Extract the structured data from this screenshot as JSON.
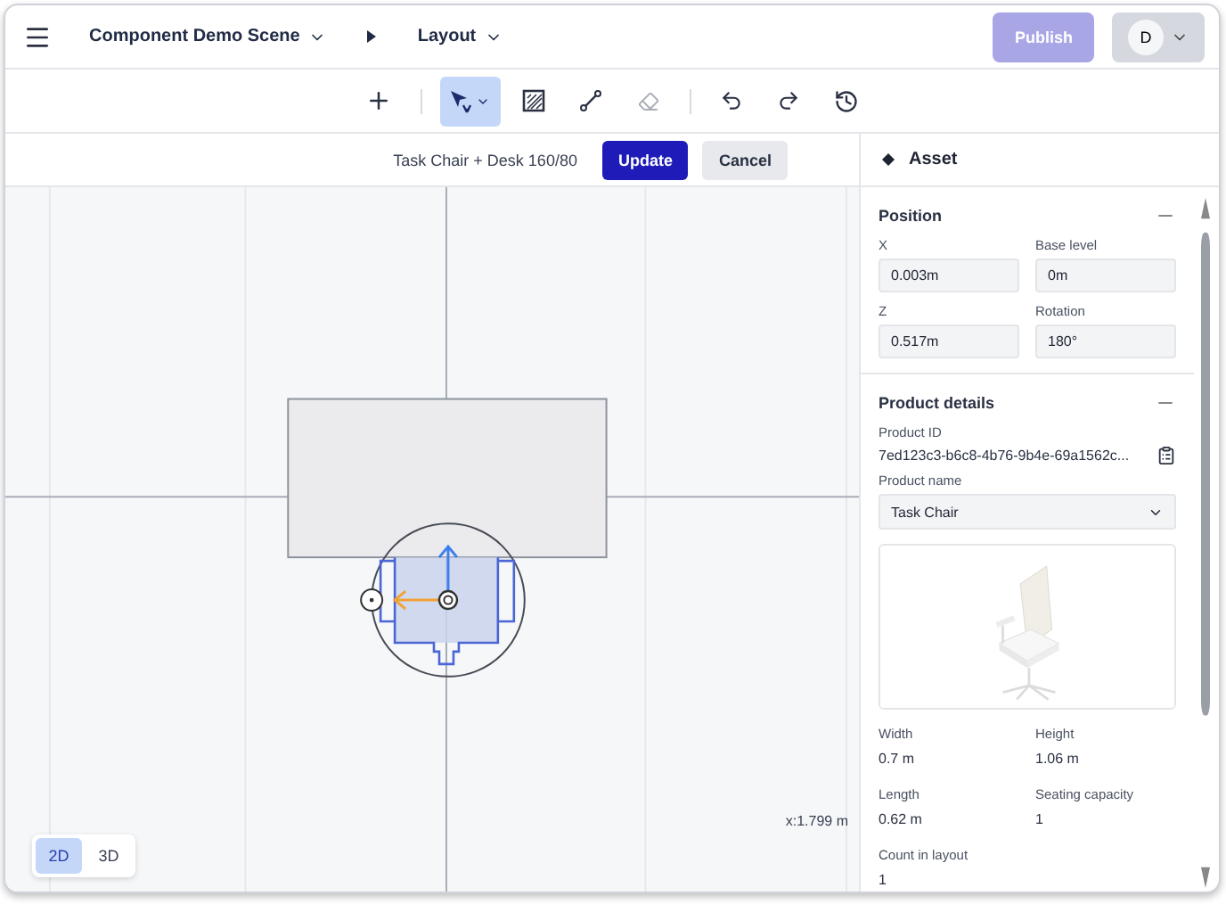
{
  "header": {
    "breadcrumbs": [
      {
        "label": "Component Demo Scene"
      },
      {
        "label": "Layout"
      }
    ],
    "publish": {
      "label": "Publish",
      "disabled": true
    },
    "avatar": "D"
  },
  "toolbar": {
    "tools": [
      {
        "kind": "add",
        "selected": false,
        "disabled": false
      },
      {
        "kind": "select",
        "selected": true,
        "disabled": false
      },
      {
        "kind": "area",
        "selected": false,
        "disabled": false
      },
      {
        "kind": "line",
        "selected": false,
        "disabled": false
      },
      {
        "kind": "erase",
        "selected": false,
        "disabled": true
      },
      {
        "kind": "undo",
        "selected": false,
        "disabled": false
      },
      {
        "kind": "redo",
        "selected": false,
        "disabled": false
      },
      {
        "kind": "history",
        "selected": false,
        "disabled": false
      }
    ]
  },
  "action_bar": {
    "selection": "Task Chair + Desk 160/80",
    "buttons": [
      {
        "label": "Update",
        "kind": "primary"
      },
      {
        "label": "Cancel",
        "kind": "secondary"
      }
    ]
  },
  "canvas": {
    "coordinate": "x:1.799 m",
    "views": [
      {
        "label": "2D",
        "selected": true
      },
      {
        "label": "3D",
        "selected": false
      }
    ]
  },
  "panel": {
    "title": "Asset",
    "sections": [
      {
        "kind": "position",
        "title": "Position",
        "expanded": true,
        "fields": [
          {
            "label": "X",
            "value": "0.003m"
          },
          {
            "label": "Base level",
            "value": "0m"
          },
          {
            "label": "Z",
            "value": "0.517m"
          },
          {
            "label": "Rotation",
            "value": "180°"
          }
        ]
      },
      {
        "kind": "product",
        "title": "Product details",
        "expanded": true,
        "id_label": "Product ID",
        "id": "7ed123c3-b6c8-4b76-9b4e-69a1562c...",
        "name_label": "Product name",
        "name": "Task Chair",
        "specs": [
          {
            "label": "Width",
            "value": "0.7 m"
          },
          {
            "label": "Height",
            "value": "1.06 m"
          },
          {
            "label": "Length",
            "value": "0.62 m"
          },
          {
            "label": "Seating capacity",
            "value": "1"
          },
          {
            "label": "Count in layout",
            "value": "1"
          }
        ]
      }
    ]
  }
}
